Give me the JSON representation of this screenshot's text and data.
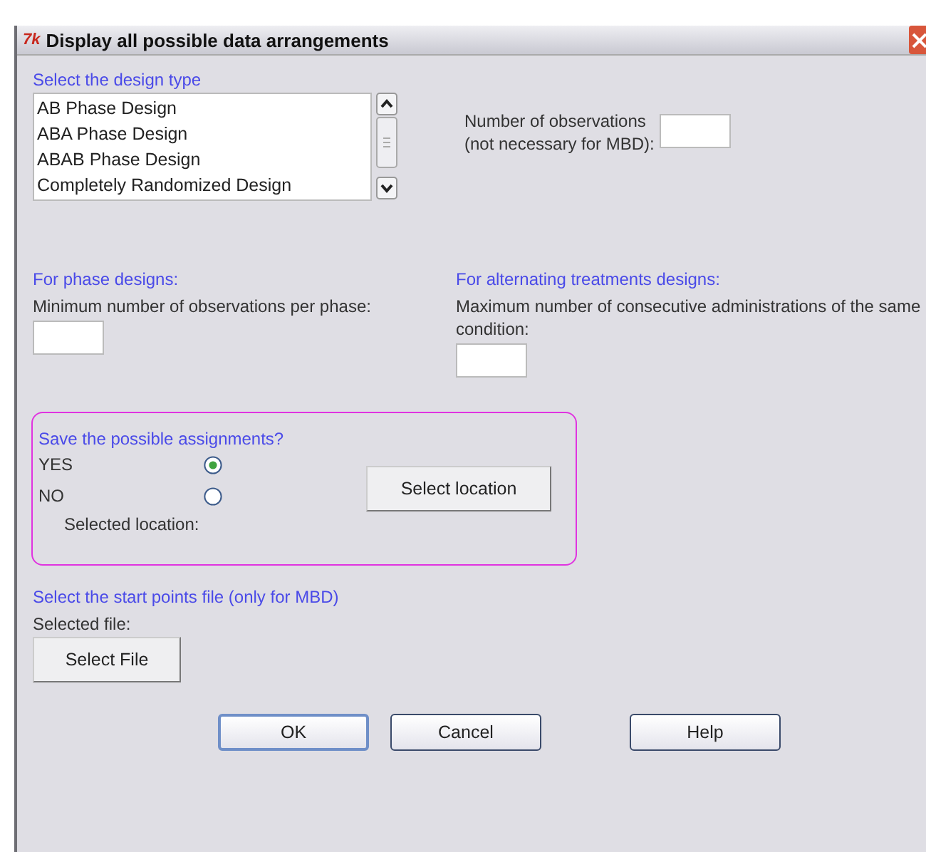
{
  "window": {
    "title": "Display all possible data arrangements",
    "app_icon": "7k"
  },
  "design_type": {
    "label": "Select the design type",
    "options": [
      "AB Phase Design",
      "ABA Phase Design",
      "ABAB Phase Design",
      "Completely Randomized Design"
    ]
  },
  "observations": {
    "label_lines": [
      "Number of observations",
      "(not necessary for MBD):"
    ]
  },
  "phase": {
    "heading": "For phase designs:",
    "label": "Minimum number of observations per phase:"
  },
  "alternating": {
    "heading": "For alternating treatments designs:",
    "label": "Maximum number of consecutive administrations of the same condition:"
  },
  "save": {
    "heading": "Save the possible assignments?",
    "options": [
      {
        "label": "YES",
        "selected": true
      },
      {
        "label": "NO",
        "selected": false
      }
    ],
    "location_label": "Selected location:",
    "button": "Select location"
  },
  "start_points": {
    "heading": "Select the start points file (only for MBD)",
    "file_label": "Selected file:",
    "button": "Select File"
  },
  "buttons": [
    {
      "label": "OK",
      "default": true
    },
    {
      "label": "Cancel",
      "default": false
    },
    {
      "label": "Help",
      "default": false
    }
  ]
}
